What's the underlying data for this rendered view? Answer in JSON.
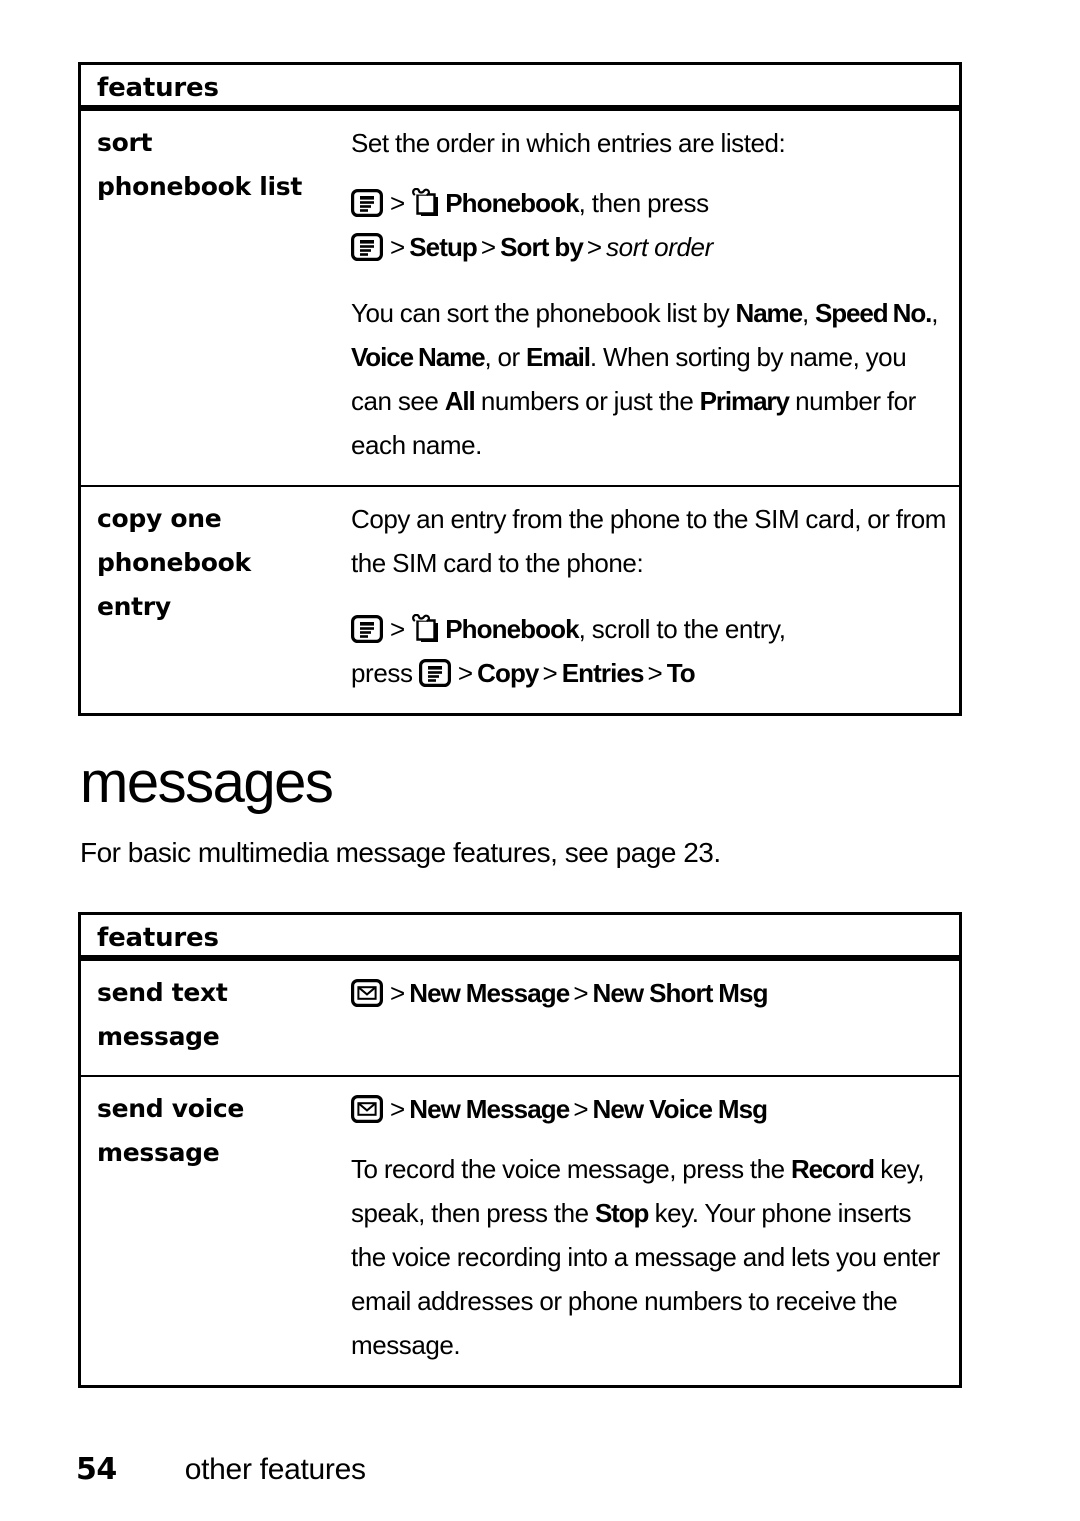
{
  "page": {
    "number": "54",
    "section_title": "other features"
  },
  "tables": [
    {
      "id": "phonebook",
      "header": "features",
      "rows": [
        {
          "label_lines": [
            "sort",
            "phonebook list"
          ],
          "body": {
            "intro": "Set the order in which entries are listed:",
            "nav_line_1": {
              "icon_1": "menu-icon",
              "sep_1": ">",
              "icon_2": "phonebook-icon",
              "item_1": "Phonebook",
              "tail": ", then press"
            },
            "nav_line_2": {
              "icon_1": "menu-icon",
              "sep_1": ">",
              "item_1": "Setup",
              "sep_2": ">",
              "item_2": "Sort by",
              "sep_3": ">",
              "item_3_italic": "sort order"
            },
            "paragraph": {
              "t1": "You can sort the phonebook list by ",
              "b1": "Name",
              "t2": ", ",
              "b2": "Speed No.",
              "t3": ", ",
              "b3": "Voice Name",
              "t4": ", or ",
              "b4": "Email",
              "t5": ". When sorting by name, you can see ",
              "b5": "All",
              "t6": " numbers or just the ",
              "b6": "Primary",
              "t7": " number for each name."
            }
          }
        },
        {
          "label_lines": [
            "copy one",
            "phonebook",
            "entry"
          ],
          "body": {
            "intro": "Copy an entry from the phone to the SIM card, or from the SIM card to the phone:",
            "nav_line_1": {
              "icon_1": "menu-icon",
              "sep_1": ">",
              "icon_2": "phonebook-icon",
              "item_1": "Phonebook",
              "tail": ", scroll to the entry,"
            },
            "nav_line_2": {
              "lead": "press ",
              "icon_1": "menu-icon",
              "sep_1": ">",
              "item_1": "Copy",
              "sep_2": ">",
              "item_2": "Entries",
              "sep_3": ">",
              "item_3": "To"
            }
          }
        }
      ]
    },
    {
      "id": "messages",
      "header": "features",
      "rows": [
        {
          "label_lines": [
            "send text",
            "message"
          ],
          "body": {
            "nav_line_1": {
              "icon_1": "envelope-icon",
              "sep_1": ">",
              "item_1": "New Message",
              "sep_2": ">",
              "item_2": "New Short Msg"
            }
          }
        },
        {
          "label_lines": [
            "send voice",
            "message"
          ],
          "body": {
            "nav_line_1": {
              "icon_1": "envelope-icon",
              "sep_1": ">",
              "item_1": "New Message",
              "sep_2": ">",
              "item_2": "New Voice Msg"
            },
            "paragraph": {
              "t1": "To record the voice message, press the ",
              "b1": "Record",
              "t2": " key, speak, then press the ",
              "b2": "Stop",
              "t3": " key. Your phone inserts the voice recording into a message and lets you enter email addresses or phone numbers to receive the message."
            }
          }
        }
      ]
    }
  ],
  "messages_section": {
    "heading": "messages",
    "intro": "For basic multimedia message features, see page 23."
  },
  "colors": {
    "ink": "#000000",
    "paper": "#ffffff"
  }
}
